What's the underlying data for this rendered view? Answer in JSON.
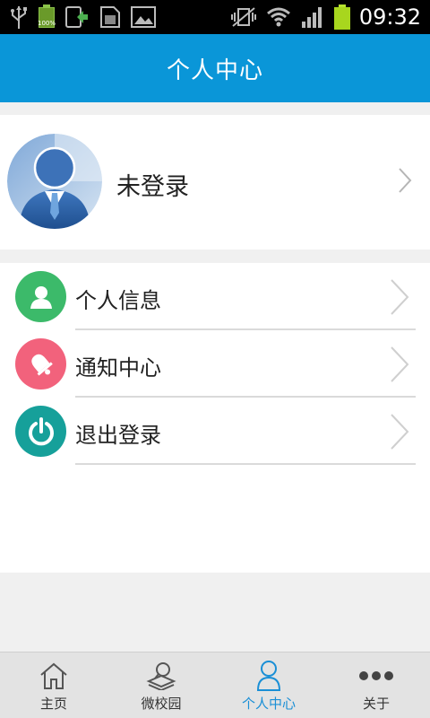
{
  "status_bar": {
    "battery_small_pct": "100%",
    "time": "09:32"
  },
  "header": {
    "title": "个人中心"
  },
  "profile": {
    "name": "未登录"
  },
  "menu": {
    "items": [
      {
        "label": "个人信息",
        "icon": "user-icon",
        "color": "#3cba6a"
      },
      {
        "label": "通知中心",
        "icon": "bell-icon",
        "color": "#f2627c"
      },
      {
        "label": "退出登录",
        "icon": "power-icon",
        "color": "#16a09a"
      }
    ]
  },
  "bottom_nav": {
    "items": [
      {
        "label": "主页",
        "icon": "home-icon"
      },
      {
        "label": "微校园",
        "icon": "campus-icon"
      },
      {
        "label": "个人中心",
        "icon": "person-icon",
        "active": true
      },
      {
        "label": "关于",
        "icon": "more-icon"
      }
    ]
  },
  "colors": {
    "accent": "#0a96d8",
    "active_nav": "#1a8fd6",
    "background": "#f0f0f0"
  }
}
